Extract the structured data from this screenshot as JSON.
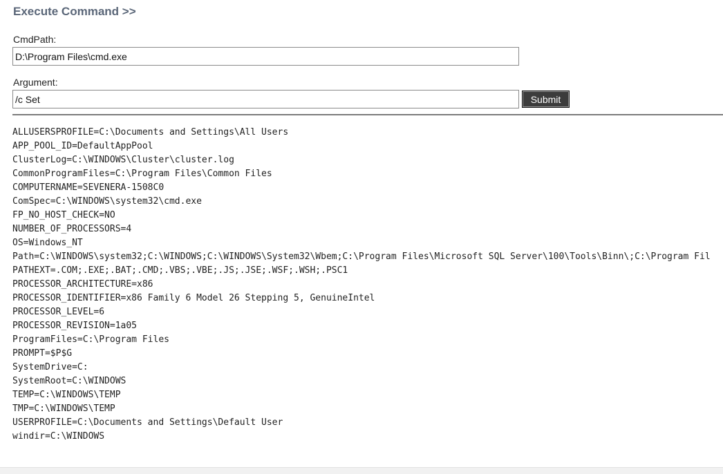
{
  "header": {
    "title": "Execute Command >>"
  },
  "form": {
    "cmdpath_label": "CmdPath:",
    "cmdpath_value": "D:\\Program Files\\cmd.exe",
    "argument_label": "Argument:",
    "argument_value": "/c Set",
    "submit_label": "Submit"
  },
  "output": {
    "lines": [
      "ALLUSERSPROFILE=C:\\Documents and Settings\\All Users",
      "APP_POOL_ID=DefaultAppPool",
      "ClusterLog=C:\\WINDOWS\\Cluster\\cluster.log",
      "CommonProgramFiles=C:\\Program Files\\Common Files",
      "COMPUTERNAME=SEVENERA-1508C0",
      "ComSpec=C:\\WINDOWS\\system32\\cmd.exe",
      "FP_NO_HOST_CHECK=NO",
      "NUMBER_OF_PROCESSORS=4",
      "OS=Windows_NT",
      "Path=C:\\WINDOWS\\system32;C:\\WINDOWS;C:\\WINDOWS\\System32\\Wbem;C:\\Program Files\\Microsoft SQL Server\\100\\Tools\\Binn\\;C:\\Program Fil",
      "PATHEXT=.COM;.EXE;.BAT;.CMD;.VBS;.VBE;.JS;.JSE;.WSF;.WSH;.PSC1",
      "PROCESSOR_ARCHITECTURE=x86",
      "PROCESSOR_IDENTIFIER=x86 Family 6 Model 26 Stepping 5, GenuineIntel",
      "PROCESSOR_LEVEL=6",
      "PROCESSOR_REVISION=1a05",
      "ProgramFiles=C:\\Program Files",
      "PROMPT=$P$G",
      "SystemDrive=C:",
      "SystemRoot=C:\\WINDOWS",
      "TEMP=C:\\WINDOWS\\TEMP",
      "TMP=C:\\WINDOWS\\TEMP",
      "USERPROFILE=C:\\Documents and Settings\\Default User",
      "windir=C:\\WINDOWS"
    ]
  }
}
